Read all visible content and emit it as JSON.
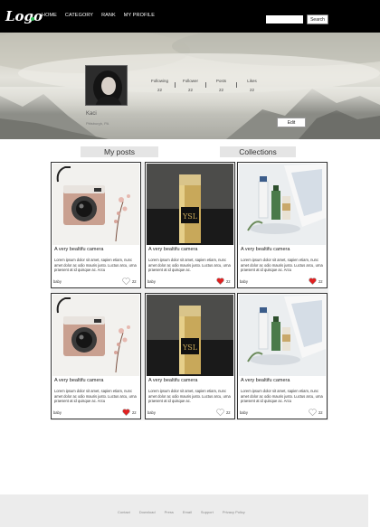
{
  "header": {
    "logo_text": "Logo",
    "nav": [
      "HOME",
      "CATEGORY",
      "RANK",
      "MY PROFILE"
    ],
    "search": {
      "placeholder": "",
      "button_label": "Search"
    }
  },
  "profile": {
    "name": "Kaci",
    "location": "Pittsburgh, PA",
    "stats": [
      {
        "label": "Following",
        "value": "22"
      },
      {
        "label": "Follower",
        "value": "22"
      },
      {
        "label": "Posts",
        "value": "22"
      },
      {
        "label": "Likes",
        "value": "22"
      }
    ],
    "edit_label": "Edit"
  },
  "tabs": {
    "posts": "My posts",
    "collections": "Collections"
  },
  "posts": [
    {
      "image": "camera",
      "title": "A very bealtifu camera",
      "desc": "Lorem ipsum dolor sit amet, sapien etiam, nunc amet dolor ac odio mauris justo. Luctus arcu, urna praesent at id quisque ac. Arcu",
      "user": "baby",
      "likes": "22",
      "liked": false
    },
    {
      "image": "lipstick",
      "title": "A very bealtifu camera",
      "desc": "Lorem ipsum dolor sit amet, sapien etiam, nunc amet dolor ac odio mauris justo. Luctus arcu, urna praesent at id quisque ac.",
      "user": "baby",
      "likes": "22",
      "liked": true
    },
    {
      "image": "skincare",
      "title": "A very bealtifu camera",
      "desc": "Lorem ipsum dolor sit amet, sapien etiam, nunc amet dolor ac odio mauris justo. Luctus arcu, urna praesent at id quisque ac. Arcu",
      "user": "baby",
      "likes": "22",
      "liked": true
    },
    {
      "image": "camera",
      "title": "A very bealtifu camera",
      "desc": "Lorem ipsum dolor sit amet, sapien etiam, nunc amet dolor ac odio mauris justo. Luctus arcu, urna praesent at id quisque ac. Arcu",
      "user": "baby",
      "likes": "22",
      "liked": true
    },
    {
      "image": "lipstick",
      "title": "A very bealtifu camera",
      "desc": "Lorem ipsum dolor sit amet, sapien etiam, nunc amet dolor ac odio mauris justo. Luctus arcu, urna praesent at id quisque ac.",
      "user": "baby",
      "likes": "22",
      "liked": false
    },
    {
      "image": "skincare",
      "title": "A very bealtifu camera",
      "desc": "Lorem ipsum dolor sit amet, sapien etiam, nunc amet dolor ac odio mauris justo. Luctus arcu, urna praesent at id quisque ac. Arcu",
      "user": "baby",
      "likes": "22",
      "liked": false
    }
  ],
  "footer": {
    "links": [
      "Contact",
      "Download",
      "Press",
      "Email",
      "Support",
      "Privacy Policy"
    ]
  },
  "colors": {
    "liked": "#e02020",
    "unliked": "#ffffff",
    "accent_dot": "#2fbf57"
  }
}
